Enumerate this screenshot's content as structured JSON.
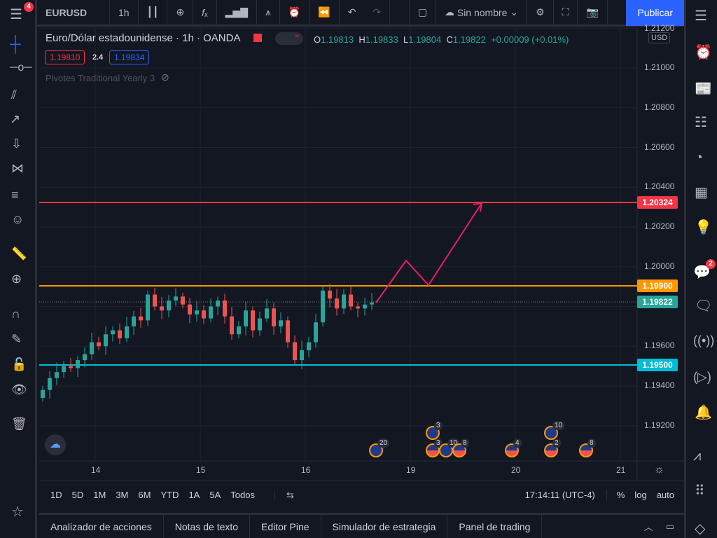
{
  "toolbar": {
    "symbol": "EURUSD",
    "interval": "1h",
    "layout_name": "Sin nombre",
    "publish": "Publicar",
    "menu_badge": "4"
  },
  "legend": {
    "title": "Euro/Dólar estadounidense · 1h · OANDA",
    "bid": "1.19810",
    "spread": "2.4",
    "ask": "1.19834",
    "O": "1.19813",
    "H": "1.19833",
    "L": "1.19804",
    "C": "1.19822",
    "change": "+0.00009 (+0.01%)",
    "indicator": "Pivotes Traditional Yearly 3"
  },
  "price_axis": {
    "currency": "USD",
    "top": "1.21200",
    "ticks": [
      "1.21000",
      "1.20800",
      "1.20600",
      "1.20400",
      "1.20200",
      "1.20000",
      "1.19600",
      "1.19400",
      "1.19200"
    ]
  },
  "levels": {
    "red": "1.20324",
    "orange": "1.19900",
    "current": "1.19822",
    "cyan": "1.19500"
  },
  "time_axis": [
    "14",
    "15",
    "16",
    "19",
    "20",
    "21"
  ],
  "events": [
    "20",
    "3",
    "3",
    "10",
    "8",
    "4",
    "10",
    "2",
    "8"
  ],
  "ranges": [
    "1D",
    "5D",
    "1M",
    "3M",
    "6M",
    "YTD",
    "1A",
    "5A",
    "Todos"
  ],
  "clock": "17:14:11 (UTC-4)",
  "scale": {
    "percent": "%",
    "log": "log",
    "auto": "auto"
  },
  "bottom_tabs": [
    "Analizador de acciones",
    "Notas de texto",
    "Editor Pine",
    "Simulador de estrategia",
    "Panel de trading"
  ],
  "right_badge": "2",
  "colors": {
    "up": "#26a69a",
    "down": "#ef5350",
    "red": "#f23645",
    "orange": "#ff9800",
    "cyan": "#00bcd4",
    "arrow": "#e91e63"
  },
  "candles": [
    1.1938,
    1.1944,
    1.1947,
    1.195,
    1.1949,
    1.1953,
    1.1956,
    1.1962,
    1.196,
    1.1966,
    1.1968,
    1.1964,
    1.197,
    1.1975,
    1.1973,
    1.1986,
    1.198,
    1.1978,
    1.1983,
    1.1985,
    1.1981,
    1.1976,
    1.1978,
    1.1974,
    1.198,
    1.1983,
    1.1975,
    1.1966,
    1.197,
    1.1978,
    1.1968,
    1.1974,
    1.1979,
    1.197,
    1.1973,
    1.1962,
    1.1953,
    1.1958,
    1.1962,
    1.1972,
    1.1988,
    1.1984,
    1.1979,
    1.1986,
    1.198,
    1.1979,
    1.1981,
    1.1982
  ]
}
